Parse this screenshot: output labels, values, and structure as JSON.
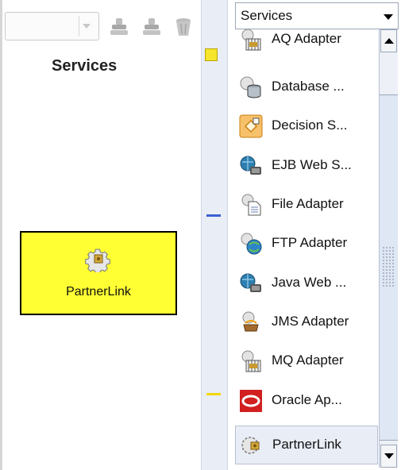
{
  "left_panel": {
    "heading": "Services",
    "component": {
      "label": "PartnerLink",
      "icon": "gear-icon",
      "fill": "#ffff33"
    }
  },
  "toolbar": {
    "icons": [
      "stamp-icon",
      "stamp-icon",
      "trash-icon"
    ]
  },
  "gutter": {
    "markers": [
      {
        "name": "yellow-square-marker",
        "color": "#f5e52c"
      },
      {
        "name": "blue-line-marker",
        "color": "#3b5fd0"
      },
      {
        "name": "yellow-line-marker",
        "color": "#f0d800"
      }
    ]
  },
  "palette": {
    "selected_category": "Services",
    "items": [
      {
        "label": "AQ Adapter",
        "icon": "aq-adapter-icon"
      },
      {
        "label": "Database ...",
        "icon": "database-icon"
      },
      {
        "label": "Decision S...",
        "icon": "decision-service-icon"
      },
      {
        "label": "EJB Web S...",
        "icon": "ejb-web-service-icon"
      },
      {
        "label": "File Adapter",
        "icon": "file-adapter-icon"
      },
      {
        "label": "FTP Adapter",
        "icon": "ftp-adapter-icon"
      },
      {
        "label": "Java Web ...",
        "icon": "java-web-service-icon"
      },
      {
        "label": "JMS Adapter",
        "icon": "jms-adapter-icon"
      },
      {
        "label": "MQ Adapter",
        "icon": "mq-adapter-icon"
      },
      {
        "label": "Oracle Ap...",
        "icon": "oracle-apps-icon"
      },
      {
        "label": "PartnerLink",
        "icon": "partnerlink-icon",
        "selected": true
      }
    ]
  }
}
